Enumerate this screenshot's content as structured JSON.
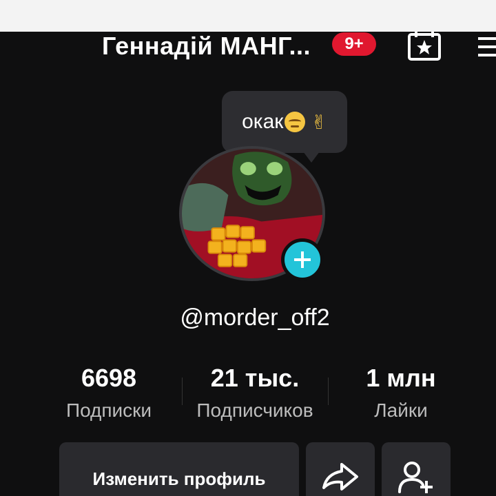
{
  "header": {
    "name": "Геннадій МАНГ...",
    "notification_count": "9+",
    "star_icon": "star-box-icon",
    "menu_icon": "hamburger-menu-icon"
  },
  "status_bubble": {
    "text": "окак",
    "emojis": [
      "flushed-face-icon",
      "victory-hand-icon"
    ]
  },
  "profile": {
    "avatar_icon": "avatar",
    "add_icon": "plus-icon",
    "handle": "@morder_off2"
  },
  "stats": [
    {
      "value": "6698",
      "label": "Подписки"
    },
    {
      "value": "21 тыс.",
      "label": "Подписчиков"
    },
    {
      "value": "1 млн",
      "label": "Лайки"
    }
  ],
  "actions": {
    "edit_label": "Изменить профиль",
    "share_icon": "share-arrow-icon",
    "add_friend_icon": "add-friend-icon"
  },
  "colors": {
    "background": "#0f0f10",
    "accent_cyan": "#23c4d9",
    "badge_red": "#e0182f",
    "button_bg": "#2a2a2e"
  }
}
